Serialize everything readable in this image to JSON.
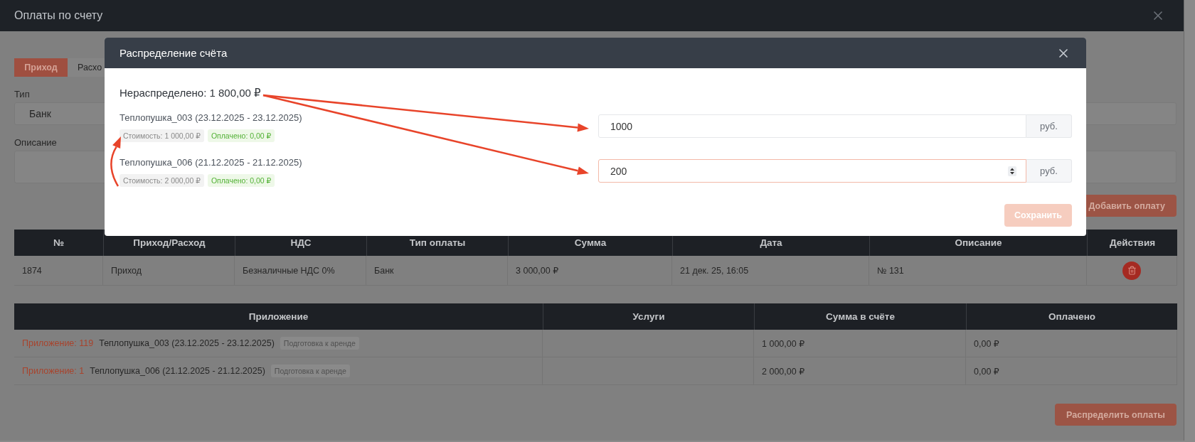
{
  "window": {
    "title": "Оплаты по счету"
  },
  "tabs": [
    {
      "label": "Приход",
      "selected": true
    },
    {
      "label": "Расхо",
      "selected": false
    }
  ],
  "form": {
    "fields": [
      {
        "label": "Тип",
        "kind": "select",
        "value": "Банк"
      },
      {
        "label": "Описание",
        "kind": "textarea"
      }
    ]
  },
  "add_button": "Добавить оплату",
  "payments_table": {
    "columns": [
      "№",
      "Приход/Расход",
      "НДС",
      "Тип оплаты",
      "Сумма",
      "Дата",
      "Описание",
      "Действия"
    ],
    "rows": [
      {
        "cells": [
          "1874",
          "Приход",
          "Безналичные НДС 0%",
          "Банк",
          "3 000,00 ₽",
          "21 дек. 25, 16:05",
          "№ 131"
        ]
      }
    ]
  },
  "appendix_table": {
    "columns": [
      "Приложение",
      "Услуги",
      "Сумма в счёте",
      "Оплачено"
    ],
    "rows": [
      {
        "link": "Приложение: 119",
        "title": "Теплопушка_003 (23.12.2025 - 23.12.2025)",
        "status": "Подготовка к аренде",
        "amount": "1 000,00 ₽",
        "paid": "0,00 ₽"
      },
      {
        "link": "Приложение: 1",
        "title": "Теплопушка_006 (21.12.2025 - 21.12.2025)",
        "status": "Подготовка к аренде",
        "amount": "2 000,00 ₽",
        "paid": "0,00 ₽"
      }
    ]
  },
  "distribute_button": "Распределить оплаты",
  "modal": {
    "title": "Распределение счёта",
    "unallocated": "Нераспределено: 1 800,00 ₽",
    "items": [
      {
        "title": "Теплопушка_003 (23.12.2025 - 23.12.2025)",
        "cost": "Стоимость: 1 000,00 ₽",
        "paid": "Оплачено: 0,00 ₽",
        "amount": "1000",
        "unit": "руб.",
        "focused": false
      },
      {
        "title": "Теплопушка_006 (21.12.2025 - 21.12.2025)",
        "cost": "Стоимость: 2 000,00 ₽",
        "paid": "Оплачено: 0,00 ₽",
        "amount": "200",
        "unit": "руб.",
        "focused": true
      }
    ],
    "save_button": {
      "label": "Сохранить",
      "disabled": true
    }
  }
}
